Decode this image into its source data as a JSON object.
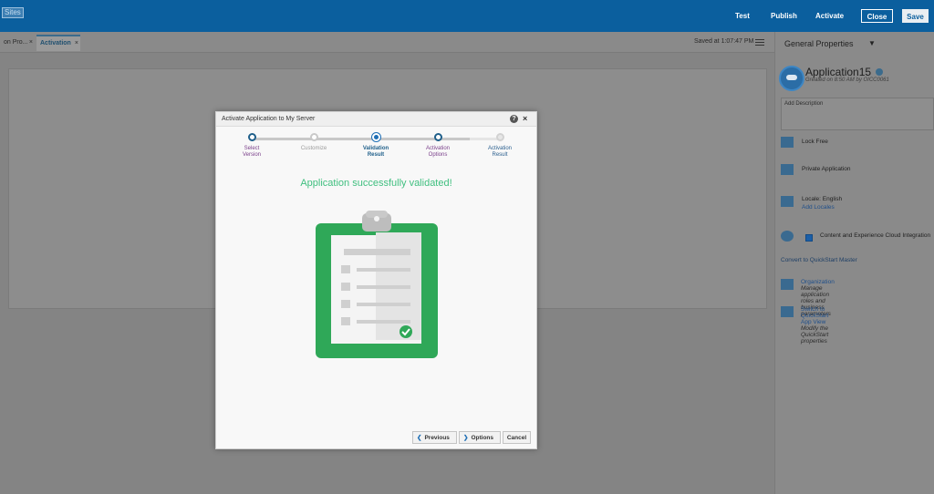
{
  "topbar": {
    "logo": "Sites",
    "test_label": "Test",
    "publish_label": "Publish",
    "activate_label": "Activate",
    "close_label": "Close",
    "save_label": "Save",
    "brand_color": "#0b5f9e"
  },
  "tabs": [
    {
      "label": "on Pro...",
      "close": "×"
    },
    {
      "label": "Activation",
      "close": "×"
    }
  ],
  "status": {
    "saved": "Saved at 1:07:47 PM"
  },
  "right_panel": {
    "title": "General Properties",
    "app_name": "Application15",
    "app_sub": "Greated on 8:50 AM by OICC0061",
    "description_placeholder": "Add Description",
    "lock": "Lock Free",
    "private": "Private Application",
    "locale": "Locale: English",
    "add_locales": "Add Locales",
    "integration": "Content and Experience Cloud Integration",
    "convert": "Convert to QuickStart Master",
    "organization": "Organization",
    "organization_sub": "Manage application roles and business parameters",
    "switch_view": "Switch to QuickStart App View",
    "switch_view_sub": "Modify the QuickStart properties"
  },
  "dialog": {
    "title": "Activate Application to My Server",
    "help": "?",
    "close": "×",
    "steps": [
      {
        "line1": "Select",
        "line2": "Version",
        "state": "visited"
      },
      {
        "line1": "Customize",
        "line2": "",
        "state": "pending"
      },
      {
        "line1": "Validation",
        "line2": "Result",
        "state": "current"
      },
      {
        "line1": "Activation",
        "line2": "Options",
        "state": "visited"
      },
      {
        "line1": "Activation",
        "line2": "Result",
        "state": "last"
      }
    ],
    "message": "Application successfully validated!",
    "previous_label": "Previous",
    "options_label": "Options",
    "cancel_label": "Cancel",
    "success_color": "#3fbf7f"
  }
}
